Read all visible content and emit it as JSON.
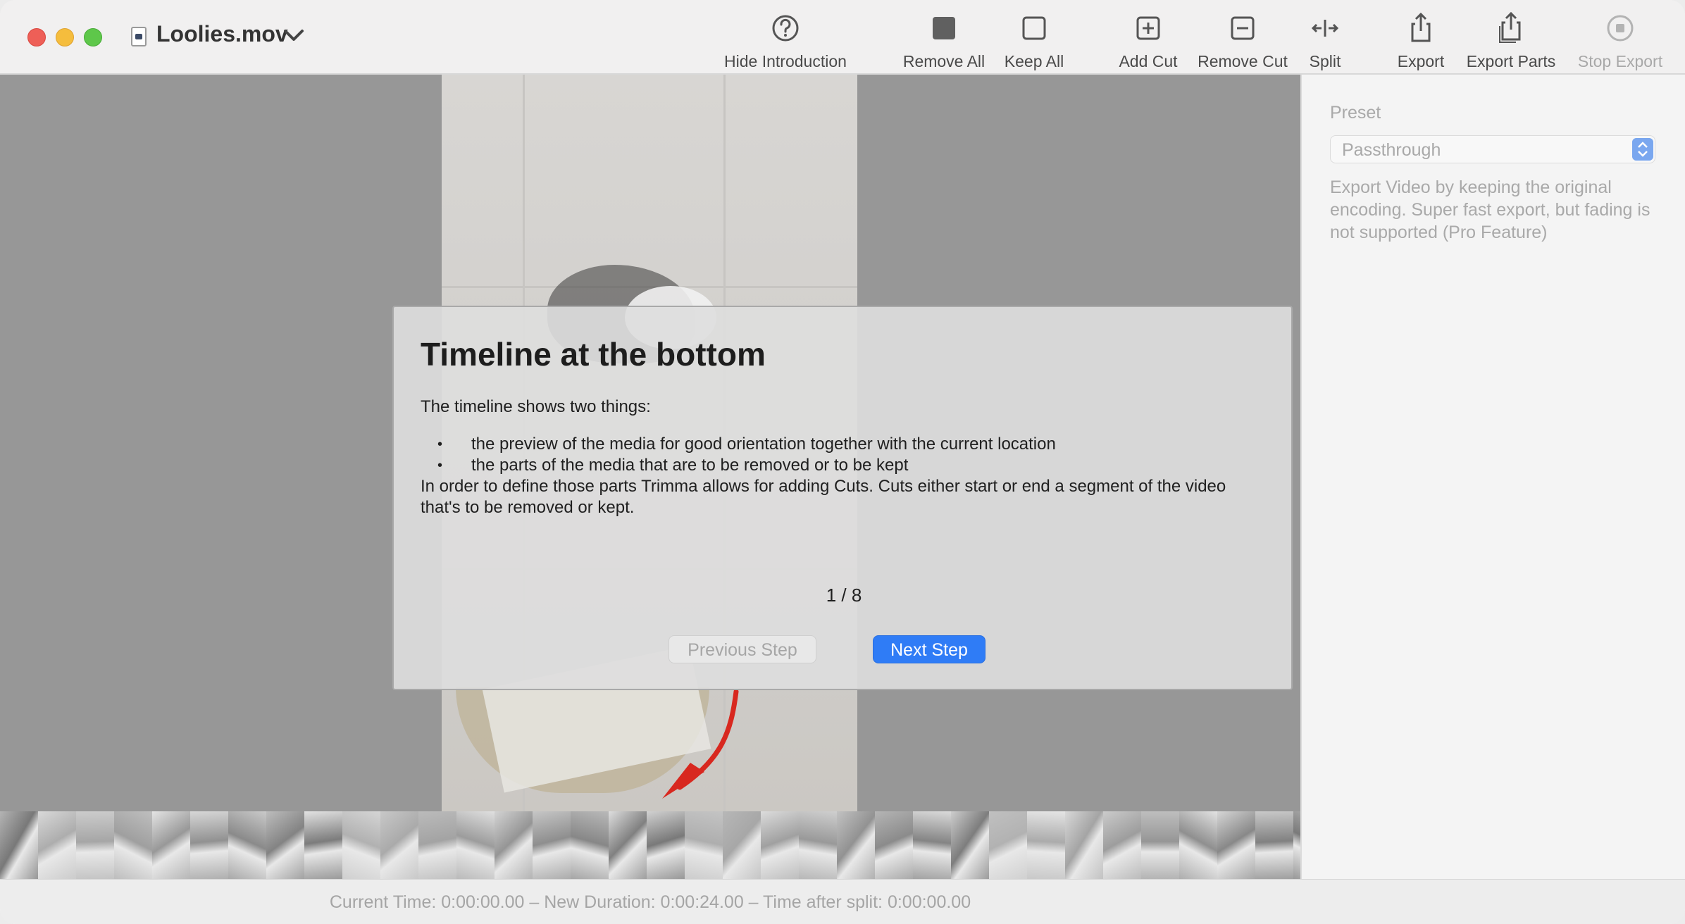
{
  "window": {
    "title": "Loolies.mov"
  },
  "toolbar": {
    "hide_intro": "Hide Introduction",
    "remove_all": "Remove All",
    "keep_all": "Keep All",
    "add_cut": "Add Cut",
    "remove_cut": "Remove Cut",
    "split": "Split",
    "export": "Export",
    "export_parts": "Export Parts",
    "stop_export": "Stop Export"
  },
  "intro": {
    "title": "Timeline at the bottom",
    "lead": "The timeline shows two things:",
    "bullets": [
      "the preview of the media for good orientation together with the current location",
      "the parts of the media that are to be removed or to be kept"
    ],
    "body": "In order to define those parts Trimma allows for adding Cuts. Cuts either start or end a segment of the video that's to be removed or kept.",
    "step_counter": "1 / 8",
    "prev_label": "Previous Step",
    "next_label": "Next Step"
  },
  "sidebar": {
    "preset_label": "Preset",
    "preset_value": "Passthrough",
    "preset_description": "Export Video by keeping the original encoding. Super fast export, but fading is not supported (Pro Feature)"
  },
  "status": {
    "text": "Current Time: 0:00:00.00 – New Duration: 0:00:24.00 – Time after split: 0:00:00.00"
  },
  "colors": {
    "accent": "#2f7cf6",
    "arrow": "#d8281f"
  },
  "icons": {
    "hide_intro": "question-circle-icon",
    "remove_all": "filled-square-icon",
    "keep_all": "empty-square-icon",
    "add_cut": "plus-square-icon",
    "remove_cut": "minus-square-icon",
    "split": "split-arrows-icon",
    "export": "share-icon",
    "export_parts": "share-stack-icon",
    "stop_export": "stop-circle-icon"
  }
}
